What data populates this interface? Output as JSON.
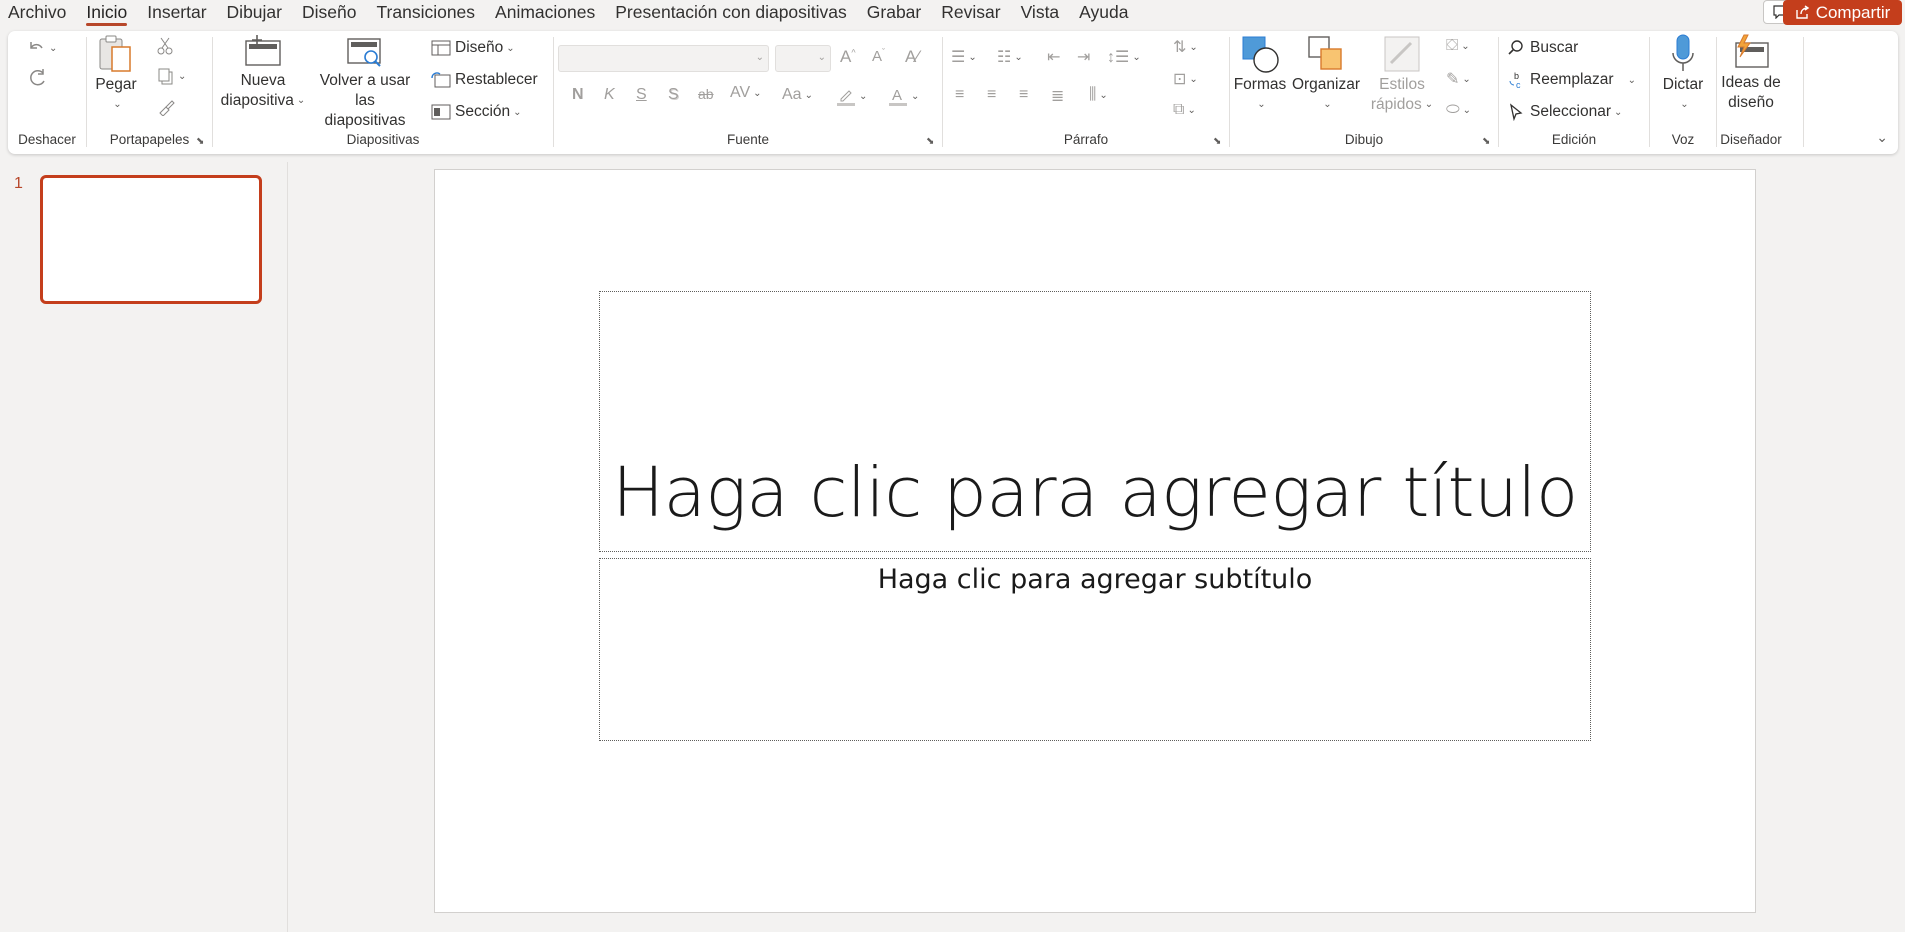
{
  "menu": {
    "items": [
      "Archivo",
      "Inicio",
      "Insertar",
      "Dibujar",
      "Diseño",
      "Transiciones",
      "Animaciones",
      "Presentación con diapositivas",
      "Grabar",
      "Revisar",
      "Vista",
      "Ayuda"
    ],
    "active": "Inicio",
    "share_label": "Compartir"
  },
  "ribbon": {
    "groups": {
      "undo": "Deshacer",
      "clipboard": "Portapapeles",
      "slides": "Diapositivas",
      "font": "Fuente",
      "paragraph": "Párrafo",
      "drawing": "Dibujo",
      "editing": "Edición",
      "voice": "Voz",
      "designer": "Diseñador"
    },
    "clipboard": {
      "paste": "Pegar"
    },
    "slides": {
      "new_slide_1": "Nueva",
      "new_slide_2": "diapositiva",
      "reuse_1": "Volver a usar",
      "reuse_2": "las diapositivas",
      "layout": "Diseño",
      "reset": "Restablecer",
      "section": "Sección"
    },
    "font": {
      "bold": "N",
      "italic": "K",
      "underline": "S",
      "shadow": "S",
      "strike": "ab",
      "spacing": "AV",
      "case": "Aa"
    },
    "drawing": {
      "shapes": "Formas",
      "arrange": "Organizar",
      "quick_styles_1": "Estilos",
      "quick_styles_2": "rápidos"
    },
    "editing": {
      "find": "Buscar",
      "replace": "Reemplazar",
      "select": "Seleccionar"
    },
    "voice": {
      "dictate": "Dictar"
    },
    "designer": {
      "ideas_1": "Ideas de",
      "ideas_2": "diseño"
    }
  },
  "thumbnails": {
    "slide_number": "1"
  },
  "slide": {
    "title_placeholder": "Haga clic para agregar título",
    "subtitle_placeholder": "Haga clic para agregar subtítulo"
  },
  "colors": {
    "accent": "#c43e1c",
    "ribbon_bg": "#ffffff",
    "app_bg": "#f3f2f1"
  }
}
